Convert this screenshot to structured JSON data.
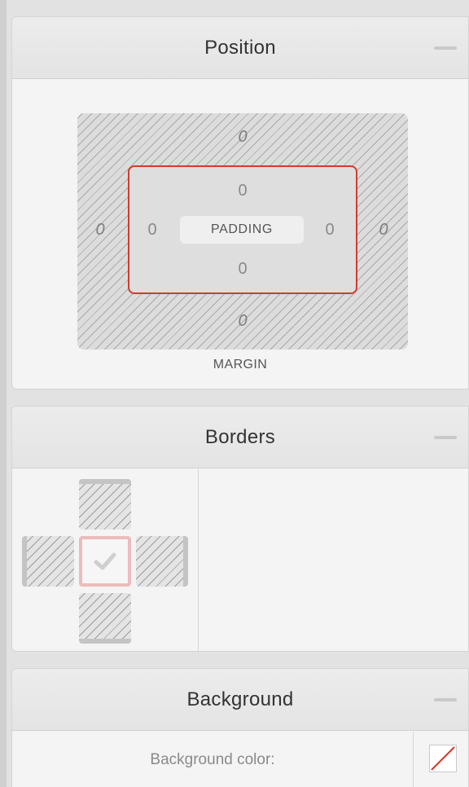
{
  "position": {
    "title": "Position",
    "margin": {
      "top": "0",
      "right": "0",
      "bottom": "0",
      "left": "0",
      "label": "MARGIN"
    },
    "padding": {
      "top": "0",
      "right": "0",
      "bottom": "0",
      "left": "0",
      "label": "PADDING"
    }
  },
  "borders": {
    "title": "Borders"
  },
  "background": {
    "title": "Background",
    "color_label": "Background color:"
  },
  "colors": {
    "accent": "#d23b2e",
    "panel": "#f4f4f4",
    "header": "#e6e6e6"
  }
}
